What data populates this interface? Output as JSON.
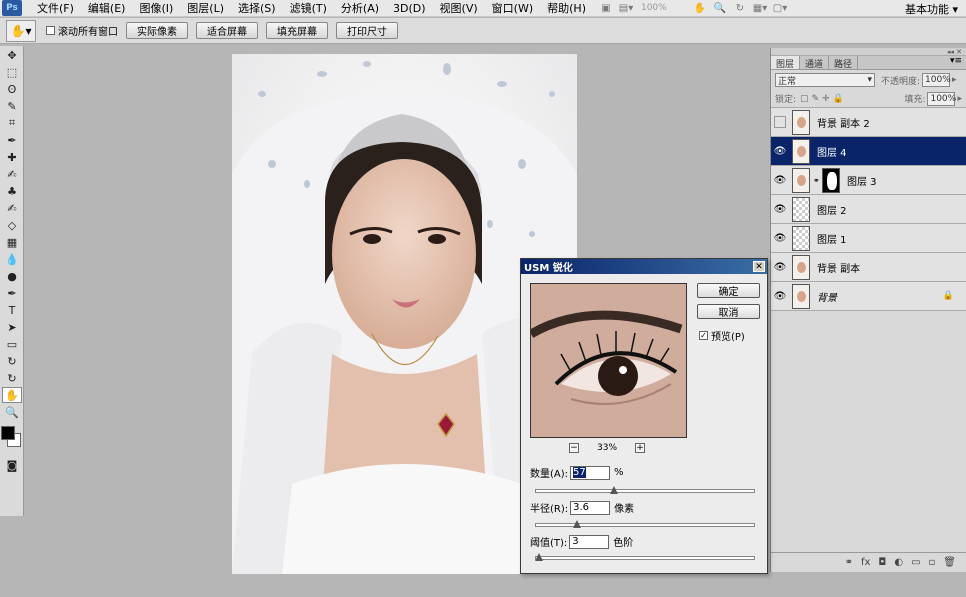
{
  "app": {
    "logo": "Ps",
    "workspace": "基本功能"
  },
  "menu": [
    "文件(F)",
    "编辑(E)",
    "图像(I)",
    "图层(L)",
    "选择(S)",
    "滤镜(T)",
    "分析(A)",
    "3D(D)",
    "视图(V)",
    "窗口(W)",
    "帮助(H)"
  ],
  "menubar": {
    "zoom": "100%"
  },
  "options": {
    "scroll_all": "滚动所有窗口",
    "buttons": [
      "实际像素",
      "适合屏幕",
      "填充屏幕",
      "打印尺寸"
    ]
  },
  "tools": [
    "move-tool",
    "marquee-tool",
    "lasso-tool",
    "quick-select-tool",
    "crop-tool",
    "eyedropper-tool",
    "healing-tool",
    "brush-tool",
    "clone-stamp-tool",
    "history-brush-tool",
    "eraser-tool",
    "gradient-tool",
    "blur-tool",
    "dodge-tool",
    "pen-tool",
    "type-tool",
    "path-select-tool",
    "shape-tool",
    "3d-rotate-tool",
    "3d-orbit-tool",
    "hand-tool",
    "zoom-tool"
  ],
  "tool_glyphs": [
    "✥",
    "⬚",
    "ʘ",
    "✎",
    "⌗",
    "✒",
    "✚",
    "✍",
    "♣",
    "✍",
    "◇",
    "▦",
    "💧",
    "●",
    "✒",
    "T",
    "➤",
    "▭",
    "↻",
    "↻",
    "✋",
    "🔍"
  ],
  "colors": {
    "foreground": "#000000",
    "background": "#ffffff"
  },
  "layers_panel": {
    "tabs": [
      "图层",
      "通道",
      "路径"
    ],
    "blend_mode": "正常",
    "opacity_label": "不透明度:",
    "opacity_value": "100%",
    "lock_label": "锁定:",
    "fill_label": "填充:",
    "fill_value": "100%",
    "layers": [
      {
        "name": "背景 副本 2",
        "visible": false,
        "selected": false,
        "thumb": "photo",
        "mask": false,
        "locked": false
      },
      {
        "name": "图层 4",
        "visible": true,
        "selected": true,
        "thumb": "photo",
        "mask": false,
        "locked": false
      },
      {
        "name": "图层 3",
        "visible": true,
        "selected": false,
        "thumb": "photo",
        "mask": true,
        "locked": false
      },
      {
        "name": "图层 2",
        "visible": true,
        "selected": false,
        "thumb": "transparent",
        "mask": false,
        "locked": false
      },
      {
        "name": "图层 1",
        "visible": true,
        "selected": false,
        "thumb": "transparent",
        "mask": false,
        "locked": false
      },
      {
        "name": "背景 副本",
        "visible": true,
        "selected": false,
        "thumb": "photo",
        "mask": false,
        "locked": false
      },
      {
        "name": "背景",
        "visible": true,
        "selected": false,
        "thumb": "photo",
        "mask": false,
        "locked": true
      }
    ]
  },
  "dialog": {
    "title": "USM 锐化",
    "ok": "确定",
    "cancel": "取消",
    "preview_label": "预览(P)",
    "zoom": "33%",
    "amount_label": "数量(A):",
    "amount_value": "57",
    "amount_unit": "%",
    "amount_fraction": 0.357,
    "radius_label": "半径(R):",
    "radius_value": "3.6",
    "radius_unit": "像素",
    "radius_fraction": 0.19,
    "threshold_label": "阈值(T):",
    "threshold_value": "3",
    "threshold_unit": "色阶",
    "threshold_fraction": 0.012
  }
}
